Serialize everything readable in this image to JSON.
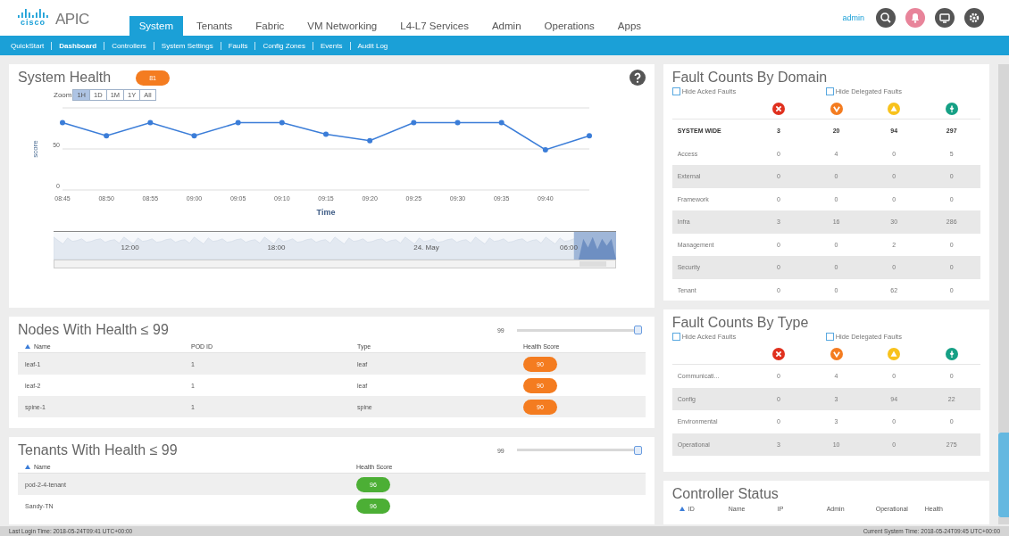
{
  "header": {
    "logo": "cisco",
    "product": "APIC",
    "tabs": [
      {
        "label": "System",
        "selected": true
      },
      {
        "label": "Tenants",
        "selected": false
      },
      {
        "label": "Fabric",
        "selected": false
      },
      {
        "label": "VM Networking",
        "selected": false
      },
      {
        "label": "L4-L7 Services",
        "selected": false
      },
      {
        "label": "Admin",
        "selected": false
      },
      {
        "label": "Operations",
        "selected": false
      },
      {
        "label": "Apps",
        "selected": false
      }
    ],
    "user": "admin"
  },
  "subnav": [
    {
      "label": "QuickStart",
      "selected": false
    },
    {
      "label": "Dashboard",
      "selected": true
    },
    {
      "label": "Controllers",
      "selected": false
    },
    {
      "label": "System Settings",
      "selected": false
    },
    {
      "label": "Faults",
      "selected": false
    },
    {
      "label": "Config Zones",
      "selected": false
    },
    {
      "label": "Events",
      "selected": false
    },
    {
      "label": "Audit Log",
      "selected": false
    }
  ],
  "system_health": {
    "title": "System Health",
    "score": "81",
    "zoom_label": "Zoom",
    "zoom": [
      {
        "label": "1H",
        "selected": true
      },
      {
        "label": "1D",
        "selected": false
      },
      {
        "label": "1M",
        "selected": false
      },
      {
        "label": "1Y",
        "selected": false
      },
      {
        "label": "All",
        "selected": false
      }
    ],
    "chart_data": {
      "type": "line",
      "xlabel": "Time",
      "ylabel": "score",
      "categories": [
        "08:45",
        "08:50",
        "08:55",
        "09:00",
        "09:05",
        "09:10",
        "09:15",
        "09:20",
        "09:25",
        "09:30",
        "09:35",
        "09:40",
        null
      ],
      "series": [
        {
          "color": "#3b7dd8",
          "marker": "circle",
          "values": [
            82,
            66,
            82,
            66,
            82,
            82,
            68,
            60,
            82,
            82,
            82,
            49,
            66
          ]
        }
      ],
      "ylim": [
        0,
        100
      ],
      "yticks": [
        0,
        50
      ]
    },
    "navigator_labels": [
      "12:00",
      "18:00",
      "24. May",
      "06:00"
    ]
  },
  "nodes": {
    "title": "Nodes With Health ≤ 99",
    "slider": {
      "reading": "99",
      "level": 1
    },
    "columns": [
      {
        "label": "Name",
        "sorted": true
      },
      {
        "label": "POD ID",
        "sorted": false
      },
      {
        "label": "Type",
        "sorted": false
      },
      {
        "label": "Health Score",
        "sorted": false
      }
    ],
    "rows": [
      {
        "name": "leaf-1",
        "pod": "1",
        "type": "leaf",
        "health": "90",
        "color": "#f47c20"
      },
      {
        "name": "leaf-2",
        "pod": "1",
        "type": "leaf",
        "health": "90",
        "color": "#f47c20"
      },
      {
        "name": "spine-1",
        "pod": "1",
        "type": "spine",
        "health": "90",
        "color": "#f47c20"
      }
    ]
  },
  "tenants": {
    "title": "Tenants With Health ≤ 99",
    "slider": {
      "reading": "99",
      "level": 1
    },
    "columns": [
      {
        "label": "Name",
        "sorted": true
      },
      {
        "label": "Health Score",
        "sorted": false
      }
    ],
    "rows": [
      {
        "name": "pod-2-4-tenant",
        "health": "96",
        "color": "#4caf35"
      },
      {
        "name": "Sandy-TN",
        "health": "96",
        "color": "#4caf35"
      }
    ]
  },
  "fault_domain": {
    "title": "Fault Counts By Domain",
    "hide_acked": {
      "label": "Hide Acked Faults",
      "checked": false
    },
    "hide_delegated": {
      "label": "Hide Delegated Faults",
      "checked": false
    },
    "rows": [
      {
        "kind": "total",
        "label": "SYSTEM WIDE",
        "counts": [
          "3",
          "20",
          "94",
          "297"
        ]
      },
      {
        "kind": "item",
        "label": "Access",
        "counts": [
          "0",
          "4",
          "0",
          "5"
        ]
      },
      {
        "kind": "item",
        "label": "External",
        "counts": [
          "0",
          "0",
          "0",
          "0"
        ]
      },
      {
        "kind": "item",
        "label": "Framework",
        "counts": [
          "0",
          "0",
          "0",
          "0"
        ]
      },
      {
        "kind": "item",
        "label": "Infra",
        "counts": [
          "3",
          "16",
          "30",
          "286"
        ]
      },
      {
        "kind": "item",
        "label": "Management",
        "counts": [
          "0",
          "0",
          "2",
          "0"
        ]
      },
      {
        "kind": "item",
        "label": "Security",
        "counts": [
          "0",
          "0",
          "0",
          "0"
        ]
      },
      {
        "kind": "item",
        "label": "Tenant",
        "counts": [
          "0",
          "0",
          "62",
          "0"
        ]
      }
    ]
  },
  "fault_type": {
    "title": "Fault Counts By Type",
    "hide_acked": {
      "label": "Hide Acked Faults",
      "checked": false
    },
    "hide_delegated": {
      "label": "Hide Delegated Faults",
      "checked": false
    },
    "rows": [
      {
        "kind": "item",
        "label": "Communicati...",
        "counts": [
          "0",
          "4",
          "0",
          "0"
        ]
      },
      {
        "kind": "item",
        "label": "Config",
        "counts": [
          "0",
          "3",
          "94",
          "22"
        ]
      },
      {
        "kind": "item",
        "label": "Environmental",
        "counts": [
          "0",
          "3",
          "0",
          "0"
        ]
      },
      {
        "kind": "item",
        "label": "Operational",
        "counts": [
          "3",
          "10",
          "0",
          "275"
        ]
      }
    ]
  },
  "controller_status": {
    "title": "Controller Status",
    "columns": [
      {
        "label": "ID",
        "sorted": true
      },
      {
        "label": "Name",
        "sorted": false
      },
      {
        "label": "IP",
        "sorted": false
      },
      {
        "label": "Admin",
        "sorted": false
      },
      {
        "label": "Operational",
        "sorted": false
      },
      {
        "label": "Health",
        "sorted": false
      }
    ]
  },
  "footer": {
    "last_login": "Last Login Time: 2018-05-24T09:41 UTC+00:00",
    "current_time": "Current System Time: 2018-05-24T09:45 UTC+00:00"
  }
}
